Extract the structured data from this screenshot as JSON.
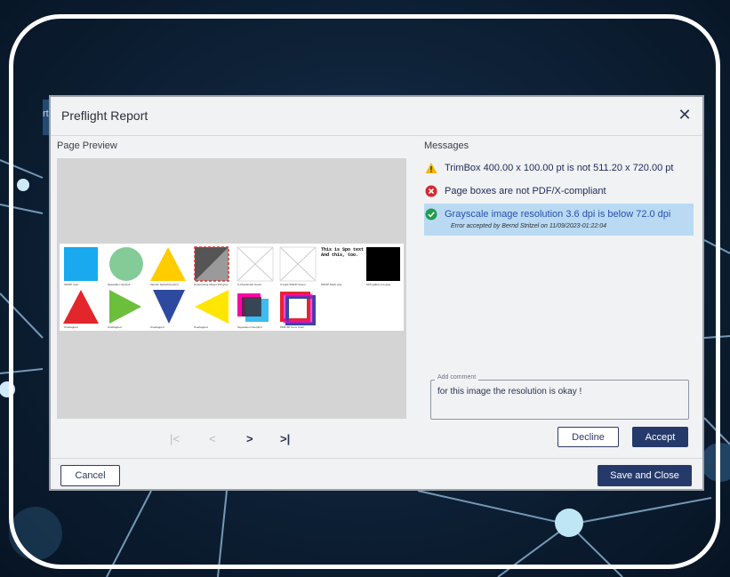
{
  "background_window": {
    "label": "rt"
  },
  "dialog": {
    "title": "Preflight Report",
    "close_icon": "close-icon",
    "page_preview_label": "Page Preview",
    "messages_label": "Messages"
  },
  "preview_page": {
    "captions_row1": [
      "SWOP cyan",
      "Separation Spotcol",
      "Varnish Spots/Overprint",
      "Overprinting Object 100 gray",
      "X-Checkmark Green",
      "X-Light SWOP Green",
      "SWOP black only",
      "SFS gallery too gray"
    ],
    "captions_row2": [
      "Overlapped",
      "Overlapped",
      "Overlapped",
      "Overlapped",
      "Separation Overprint",
      "PMS SP Conv Color"
    ],
    "text_block": "This is Spo text And this, too."
  },
  "pager": {
    "first": "|<",
    "prev": "<",
    "next": ">",
    "last": ">|"
  },
  "messages": [
    {
      "icon": "warning-icon",
      "status": "warning",
      "text": "TrimBox 400.00 x 100.00 pt is not 511.20 x 720.00 pt"
    },
    {
      "icon": "error-icon",
      "status": "error",
      "text": "Page boxes are not PDF/X-compliant"
    },
    {
      "icon": "check-icon",
      "status": "accepted",
      "text": "Grayscale image resolution 3.6 dpi is below 72.0 dpi",
      "note": "Error accepted by Bernd Stritzel on 11/09/2023-01:22:04"
    }
  ],
  "comment": {
    "legend": "Add comment",
    "value": "for this image the resolution is okay !"
  },
  "buttons": {
    "decline": "Decline",
    "accept": "Accept",
    "cancel": "Cancel",
    "save_close": "Save and Close"
  },
  "colors": {
    "primary": "#253a6a",
    "selected_row": "#b9daf2",
    "warning": "#f2b705",
    "error": "#d9262e",
    "success": "#1f9d4c"
  }
}
